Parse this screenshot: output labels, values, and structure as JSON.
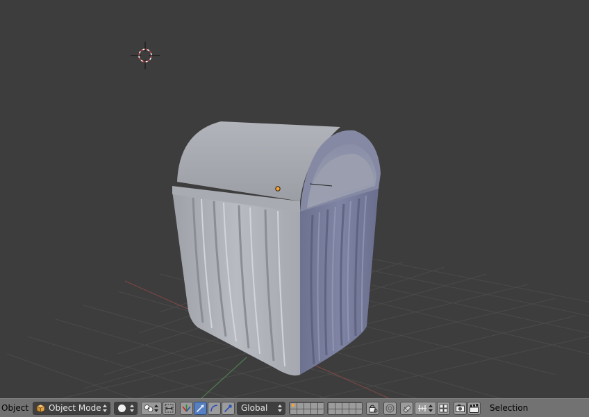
{
  "header": {
    "menu_object": "Object",
    "mode_label": "Object Mode",
    "orientation_label": "Global",
    "status_label": "Selection"
  },
  "icons": {
    "cursor": "3d-cursor-icon",
    "origin": "object-origin-icon",
    "mode": "cube-icon",
    "shading": "solid-shading-icon",
    "pivot": "pivot-point-icon",
    "manipulator": "manipulator-toggle-icon",
    "translate": "translate-arrow-icon",
    "rotate": "rotate-arc-icon",
    "scale": "scale-icon",
    "lock": "lock-layer-icon",
    "proportional": "proportional-edit-icon",
    "snap": "snap-magnet-icon",
    "snap_element": "snap-element-icon",
    "render": "render-camera-icon",
    "clapboard": "clapboard-icon"
  },
  "colors": {
    "viewport_bg": "#3d3d3d",
    "header_bg": "#727272",
    "active_blue": "#5680c2"
  }
}
